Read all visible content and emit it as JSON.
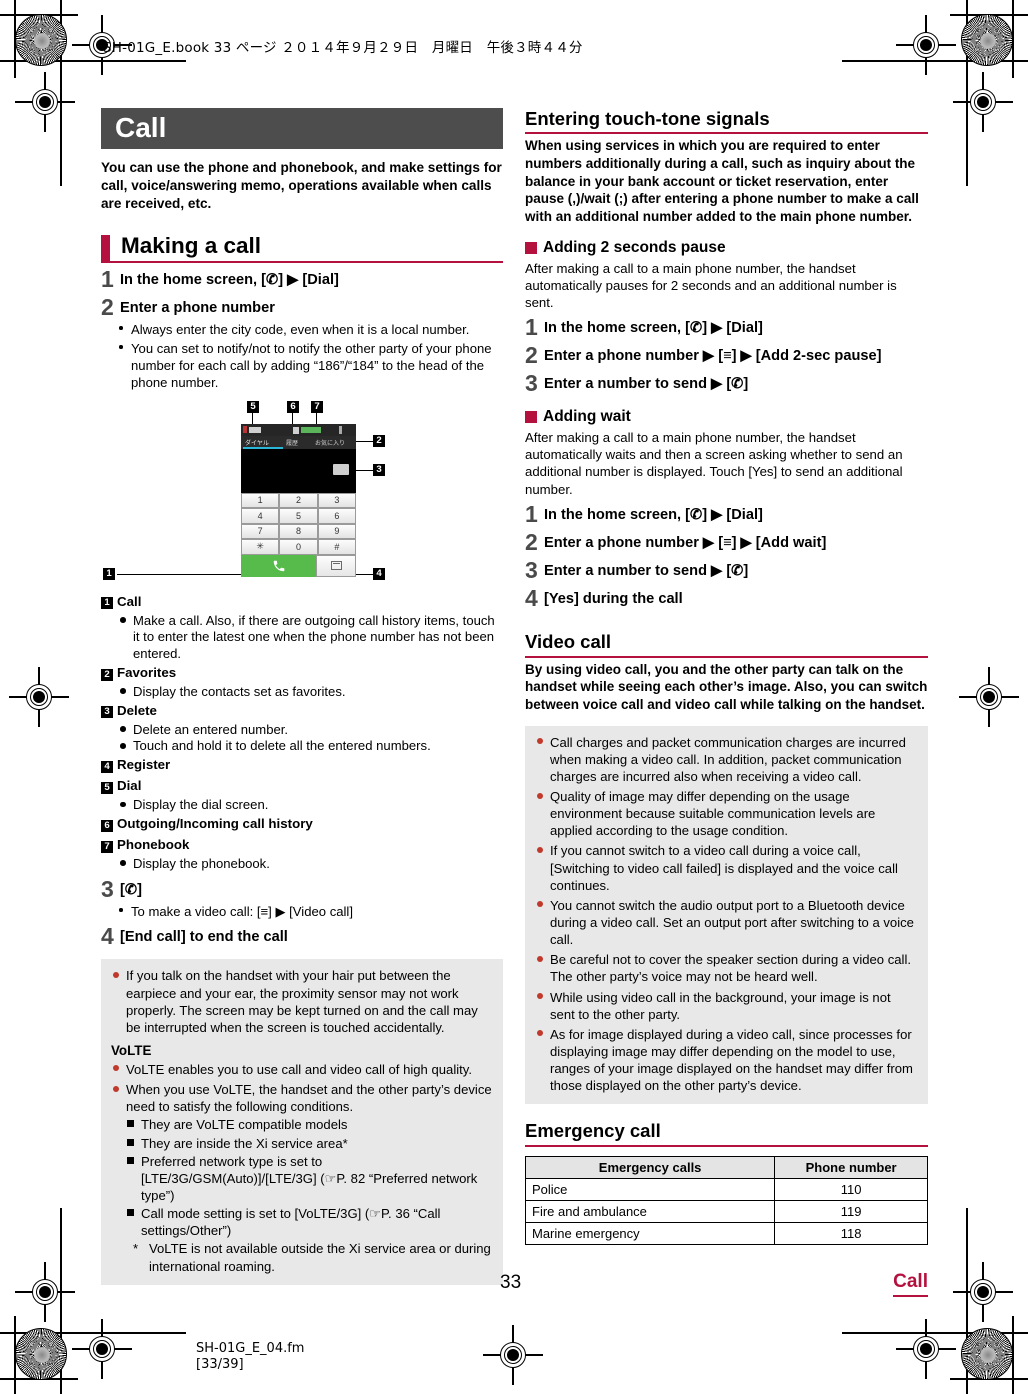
{
  "file_header": "SH-01G_E.book  33 ページ  ２０１４年９月２９日　月曜日　午後３時４４分",
  "chapter": {
    "banner": "Call"
  },
  "intro": "You can use the phone and phonebook, and make settings for call, voice/answering memo, operations available when calls are received, etc.",
  "left": {
    "h1_making_a_call": "Making a call",
    "steps": [
      {
        "n": "1",
        "text": "In the home screen, [✆] ▶ [Dial]"
      },
      {
        "n": "2",
        "text": "Enter a phone number"
      }
    ],
    "step2_subs": [
      "Always enter the city code, even when it is a local number.",
      "You can set to notify/not to notify the other party of your phone number for each call by adding “186”/“184” to the head of the phone number."
    ],
    "figure": {
      "callouts": [
        "1",
        "2",
        "3",
        "4",
        "5",
        "6",
        "7"
      ],
      "keys": [
        "1",
        "2",
        "3",
        "4",
        "5",
        "6",
        "7",
        "8",
        "9",
        "✳",
        "0",
        "#"
      ],
      "tabs": [
        "ダイヤル",
        "履歴",
        "お気に入り"
      ],
      "call_button_icon": "phone-handset-icon",
      "register_button_icon": "register-icon"
    },
    "legend": [
      {
        "n": "1",
        "label": "Call",
        "subs": [
          "Make a call. Also, if there are outgoing call history items, touch it to enter the latest one when the phone number has not been entered."
        ]
      },
      {
        "n": "2",
        "label": "Favorites",
        "subs": [
          "Display the contacts set as favorites."
        ]
      },
      {
        "n": "3",
        "label": "Delete",
        "subs": [
          "Delete an entered number.",
          "Touch and hold it to delete all the entered numbers."
        ]
      },
      {
        "n": "4",
        "label": "Register",
        "subs": []
      },
      {
        "n": "5",
        "label": "Dial",
        "subs": [
          "Display the dial screen."
        ]
      },
      {
        "n": "6",
        "label": "Outgoing/Incoming call history",
        "subs": []
      },
      {
        "n": "7",
        "label": "Phonebook",
        "subs": [
          "Display the phonebook."
        ]
      }
    ],
    "step3": {
      "n": "3",
      "text": "[✆]"
    },
    "step3_sub": "To make a video call: [≡] ▶ [Video call]",
    "step4": {
      "n": "4",
      "text": "[End call] to end the call"
    },
    "note1": {
      "items": [
        "If you talk on the handset with your hair put between the earpiece and your ear, the proximity sensor may not work properly. The screen may be kept turned on and the call may be interrupted when the screen is touched accidentally."
      ],
      "volte_head": "VoLTE",
      "volte_items": [
        "VoLTE enables you to use call and video call of high quality.",
        "When you use VoLTE, the handset and the other party’s device need to satisfy the following conditions."
      ],
      "conditions": [
        "They are VoLTE compatible models",
        "They are inside the Xi service area*",
        "Preferred network type is set to [LTE/3G/GSM(Auto)]/[LTE/3G] (☞P. 82 “Preferred network type”)",
        "Call mode setting is set to [VoLTE/3G] (☞P. 36 “Call settings/Other”)"
      ],
      "footnote_marker": "*",
      "footnote": "VoLTE is not available outside the Xi service area or during international roaming."
    }
  },
  "right": {
    "h2_touch_tone": "Entering touch-tone signals",
    "touch_tone_intro": "When using services in which you are required to enter numbers additionally during a call, such as inquiry about the balance in your bank account or ticket reservation, enter pause (,)/wait (;) after entering a phone number to make a call with an additional number added to the main phone number.",
    "h3_pause": "Adding 2 seconds pause",
    "pause_intro": "After making a call to a main phone number, the handset automatically pauses for 2 seconds and an additional number is sent.",
    "pause_steps": [
      {
        "n": "1",
        "text": "In the home screen, [✆] ▶ [Dial]"
      },
      {
        "n": "2",
        "text": "Enter a phone number ▶ [≡] ▶ [Add 2-sec pause]"
      },
      {
        "n": "3",
        "text": "Enter a number to send ▶ [✆]"
      }
    ],
    "h3_wait": "Adding wait",
    "wait_intro": "After making a call to a main phone number, the handset automatically waits and then a screen asking whether to send an additional number is displayed. Touch [Yes] to send an additional number.",
    "wait_steps": [
      {
        "n": "1",
        "text": "In the home screen, [✆] ▶ [Dial]"
      },
      {
        "n": "2",
        "text": "Enter a phone number ▶ [≡] ▶ [Add wait]"
      },
      {
        "n": "3",
        "text": "Enter a number to send ▶ [✆]"
      },
      {
        "n": "4",
        "text": "[Yes] during the call"
      }
    ],
    "h2_video_call": "Video call",
    "video_call_intro": "By using video call, you and the other party can talk on the handset while seeing each other’s image. Also, you can switch between voice call and video call while talking on the handset.",
    "video_note_items": [
      "Call charges and packet communication charges are incurred when making a video call. In addition, packet communication charges are incurred also when receiving a video call.",
      "Quality of image may differ depending on the usage environment because suitable communication levels are applied according to the usage condition.",
      "If you cannot switch to a video call during a voice call, [Switching to video call failed] is displayed and the voice call continues.",
      "You cannot switch the audio output port to a Bluetooth device during a video call. Set an output port after switching to a voice call.",
      "Be careful not to cover the speaker section during a video call. The other party’s voice may not be heard well.",
      "While using video call in the background, your image is not sent to the other party.",
      "As for image displayed during a video call, since processes for displaying image may differ depending on the model to use, ranges of your image displayed on the handset may differ from those displayed on the other party’s device."
    ],
    "h2_emergency": "Emergency call",
    "emergency_table": {
      "headers": [
        "Emergency calls",
        "Phone number"
      ],
      "rows": [
        [
          "Police",
          "110"
        ],
        [
          "Fire and ambulance",
          "119"
        ],
        [
          "Marine emergency",
          "118"
        ]
      ]
    }
  },
  "footer": {
    "page_number": "33",
    "running_head": "Call",
    "fm_file": "SH-01G_E_04.fm",
    "fm_pages": "[33/39]"
  },
  "colors": {
    "accent_red": "#b5113f",
    "banner_gray": "#4d4d4d",
    "note_bg": "#e8e8e8",
    "bullet_red": "#c0392b",
    "call_green": "#57bb4b"
  }
}
